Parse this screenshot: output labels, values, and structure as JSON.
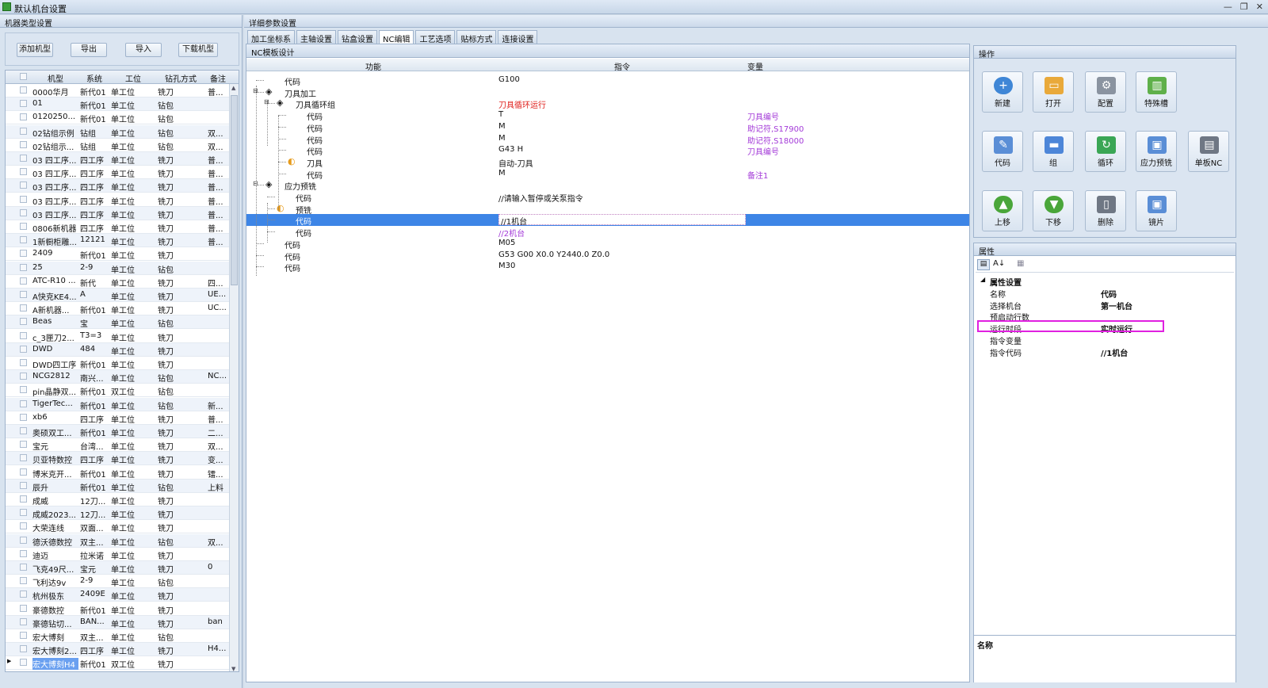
{
  "window": {
    "title": "默认机台设置",
    "min": "—",
    "restore": "❐",
    "close": "✕"
  },
  "left": {
    "panel_title": "机器类型设置",
    "buttons": [
      "添加机型",
      "导出",
      "导入",
      "下载机型"
    ],
    "columns": [
      "机型",
      "系统",
      "工位",
      "钻孔方式",
      "备注"
    ],
    "rows": [
      [
        "0000华月",
        "新代01",
        "单工位",
        "铣刀",
        "普..."
      ],
      [
        "01",
        "新代01",
        "单工位",
        "钻包",
        ""
      ],
      [
        "0120250...",
        "新代01",
        "单工位",
        "钻包",
        ""
      ],
      [
        "02钻组示例",
        "钻组",
        "单工位",
        "钻包",
        "双..."
      ],
      [
        "02钻组示...",
        "钻组",
        "单工位",
        "钻包",
        "双..."
      ],
      [
        "03 四工序...",
        "四工序",
        "单工位",
        "铣刀",
        "普..."
      ],
      [
        "03 四工序...",
        "四工序",
        "单工位",
        "铣刀",
        "普..."
      ],
      [
        "03 四工序...",
        "四工序",
        "单工位",
        "铣刀",
        "普..."
      ],
      [
        "03 四工序...",
        "四工序",
        "单工位",
        "铣刀",
        "普..."
      ],
      [
        "03 四工序...",
        "四工序",
        "单工位",
        "铣刀",
        "普..."
      ],
      [
        "0806新机器",
        "四工序",
        "单工位",
        "铣刀",
        "普..."
      ],
      [
        "1新橱柜雕...",
        "12121",
        "单工位",
        "铣刀",
        "普..."
      ],
      [
        "2409",
        "新代01",
        "单工位",
        "铣刀",
        ""
      ],
      [
        "25",
        "2-9",
        "单工位",
        "钻包",
        ""
      ],
      [
        "ATC-R10 ...",
        "新代",
        "单工位",
        "铣刀",
        "四..."
      ],
      [
        "A快克KE4...",
        "A",
        "单工位",
        "铣刀",
        "UE..."
      ],
      [
        "A新机器...",
        "新代01",
        "单工位",
        "铣刀",
        "UC..."
      ],
      [
        "Beas",
        "宝",
        "单工位",
        "钻包",
        ""
      ],
      [
        "c_3匣刀2...",
        "T3=3",
        "单工位",
        "铣刀",
        ""
      ],
      [
        "DWD",
        "484",
        "单工位",
        "铣刀",
        ""
      ],
      [
        "DWD四工序",
        "新代01",
        "单工位",
        "铣刀",
        ""
      ],
      [
        "NCG2812",
        "南兴...",
        "单工位",
        "钻包",
        "NC..."
      ],
      [
        "pin晶静双...",
        "新代01",
        "双工位",
        "钻包",
        ""
      ],
      [
        "TigerTec...",
        "新代01",
        "单工位",
        "钻包",
        "新..."
      ],
      [
        "xb6",
        "四工序",
        "单工位",
        "铣刀",
        "普..."
      ],
      [
        "奥硕双工...",
        "新代01",
        "单工位",
        "铣刀",
        "二..."
      ],
      [
        "宝元",
        "台湾...",
        "单工位",
        "铣刀",
        "双..."
      ],
      [
        "贝亚特数控",
        "四工序",
        "单工位",
        "铣刀",
        "变..."
      ],
      [
        "博米克开...",
        "新代01",
        "单工位",
        "铣刀",
        "镭..."
      ],
      [
        "辰升",
        "新代01",
        "单工位",
        "钻包",
        "上料"
      ],
      [
        "成威",
        "12刀...",
        "单工位",
        "铣刀",
        ""
      ],
      [
        "成威2023...",
        "12刀...",
        "单工位",
        "铣刀",
        ""
      ],
      [
        "大荣连线",
        "双面...",
        "单工位",
        "铣刀",
        ""
      ],
      [
        "德沃德数控",
        "双主...",
        "单工位",
        "钻包",
        "双..."
      ],
      [
        "迪迈",
        "拉米诺",
        "单工位",
        "铣刀",
        ""
      ],
      [
        "飞克49尺...",
        "宝元",
        "单工位",
        "铣刀",
        "0"
      ],
      [
        "飞利达9v",
        "2-9",
        "单工位",
        "钻包",
        ""
      ],
      [
        "杭州极东",
        "2409E",
        "单工位",
        "铣刀",
        ""
      ],
      [
        "豪德数控",
        "新代01",
        "单工位",
        "铣刀",
        ""
      ],
      [
        "豪德钻切...",
        "BAN...",
        "单工位",
        "铣刀",
        "ban"
      ],
      [
        "宏大博刻",
        "双主...",
        "单工位",
        "钻包",
        ""
      ],
      [
        "宏大博刻2...",
        "四工序",
        "单工位",
        "铣刀",
        "H4..."
      ],
      [
        "宏大博刻H4",
        "新代01",
        "双工位",
        "铣刀",
        ""
      ]
    ]
  },
  "main": {
    "panel_title": "详细参数设置",
    "tabs": [
      "加工坐标系",
      "主轴设置",
      "钻盒设置",
      "NC编辑",
      "工艺选项",
      "贴标方式",
      "连接设置"
    ],
    "active_tab": 3,
    "nc_title": "NC模板设计",
    "nc_columns": [
      "功能",
      "指令",
      "变量"
    ],
    "nc_rows": [
      {
        "depth": 0,
        "icon": "none",
        "func": "代码",
        "cmd": "G100",
        "var": "",
        "cmd_color": "normal"
      },
      {
        "depth": 0,
        "icon": "layers",
        "func": "刀具加工",
        "cmd": "",
        "var": "",
        "cmd_color": "normal"
      },
      {
        "depth": 1,
        "icon": "layers",
        "func": "刀具循环组",
        "cmd": "刀具循环运行",
        "var": "",
        "cmd_color": "red"
      },
      {
        "depth": 2,
        "icon": "none",
        "func": "代码",
        "cmd": "T",
        "var": "刀具编号",
        "cmd_color": "normal"
      },
      {
        "depth": 2,
        "icon": "none",
        "func": "代码",
        "cmd": "M",
        "var": "助记符,S17900",
        "cmd_color": "normal"
      },
      {
        "depth": 2,
        "icon": "none",
        "func": "代码",
        "cmd": "M",
        "var": "助记符,S18000",
        "cmd_color": "normal"
      },
      {
        "depth": 2,
        "icon": "none",
        "func": "代码",
        "cmd": "G43 H",
        "var": "刀具编号",
        "cmd_color": "normal"
      },
      {
        "depth": 2,
        "icon": "tool",
        "func": "刀具",
        "cmd": "自动-刀具",
        "var": "",
        "cmd_color": "normal"
      },
      {
        "depth": 2,
        "icon": "none",
        "func": "代码",
        "cmd": "M",
        "var": "备注1",
        "cmd_color": "normal"
      },
      {
        "depth": 0,
        "icon": "layers",
        "func": "应力预铣",
        "cmd": "",
        "var": "",
        "cmd_color": "normal"
      },
      {
        "depth": 1,
        "icon": "none",
        "func": "代码",
        "cmd": "//请输入暂停或关泵指令",
        "var": "",
        "cmd_color": "normal"
      },
      {
        "depth": 1,
        "icon": "tool",
        "func": "预铣",
        "cmd": "",
        "var": "",
        "cmd_color": "normal"
      },
      {
        "depth": 1,
        "icon": "none",
        "func": "代码",
        "cmd": "//1机台",
        "var": "",
        "cmd_color": "normal",
        "selected": true
      },
      {
        "depth": 1,
        "icon": "none",
        "func": "代码",
        "cmd": "//2机台",
        "var": "",
        "cmd_color": "purple"
      },
      {
        "depth": 0,
        "icon": "none",
        "func": "代码",
        "cmd": "M05",
        "var": "",
        "cmd_color": "normal"
      },
      {
        "depth": 0,
        "icon": "none",
        "func": "代码",
        "cmd": "G53 G00 X0.0 Y2440.0 Z0.0",
        "var": "",
        "cmd_color": "normal"
      },
      {
        "depth": 0,
        "icon": "none",
        "func": "代码",
        "cmd": "M30",
        "var": "",
        "cmd_color": "normal"
      }
    ]
  },
  "ops": {
    "title": "操作",
    "buttons": [
      {
        "label": "新建",
        "icon": "new-icon",
        "color": "#3f86d6"
      },
      {
        "label": "打开",
        "icon": "folder-open-icon",
        "color": "#e9a93a"
      },
      {
        "label": "配置",
        "icon": "gear-icon",
        "color": "#8a93a0"
      },
      {
        "label": "特殊槽",
        "icon": "slot-icon",
        "color": "#5fb04a"
      },
      {
        "label": "代码",
        "icon": "code-icon",
        "color": "#5a8ed6"
      },
      {
        "label": "组",
        "icon": "group-icon",
        "color": "#4d86d8"
      },
      {
        "label": "循环",
        "icon": "loop-icon",
        "color": "#3aa655"
      },
      {
        "label": "应力预铣",
        "icon": "pre-mill-icon",
        "color": "#5a8ed6"
      },
      {
        "label": "单板NC",
        "icon": "book-icon",
        "color": "#6f7784"
      },
      {
        "label": "上移",
        "icon": "arrow-up-icon",
        "color": "#4aa63a"
      },
      {
        "label": "下移",
        "icon": "arrow-down-icon",
        "color": "#4aa63a"
      },
      {
        "label": "删除",
        "icon": "trash-icon",
        "color": "#6f7784"
      },
      {
        "label": "镜片",
        "icon": "mirror-icon",
        "color": "#5a8ed6"
      }
    ]
  },
  "props": {
    "title": "属性",
    "category": "属性设置",
    "rows": [
      {
        "name": "名称",
        "value": "代码"
      },
      {
        "name": "选择机台",
        "value": "第一机台"
      },
      {
        "name": "预启动行数",
        "value": ""
      },
      {
        "name": "运行时段",
        "value": "实时运行"
      },
      {
        "name": "指令变量",
        "value": ""
      },
      {
        "name": "指令代码",
        "value": "//1机台"
      }
    ],
    "desc_title": "名称"
  }
}
